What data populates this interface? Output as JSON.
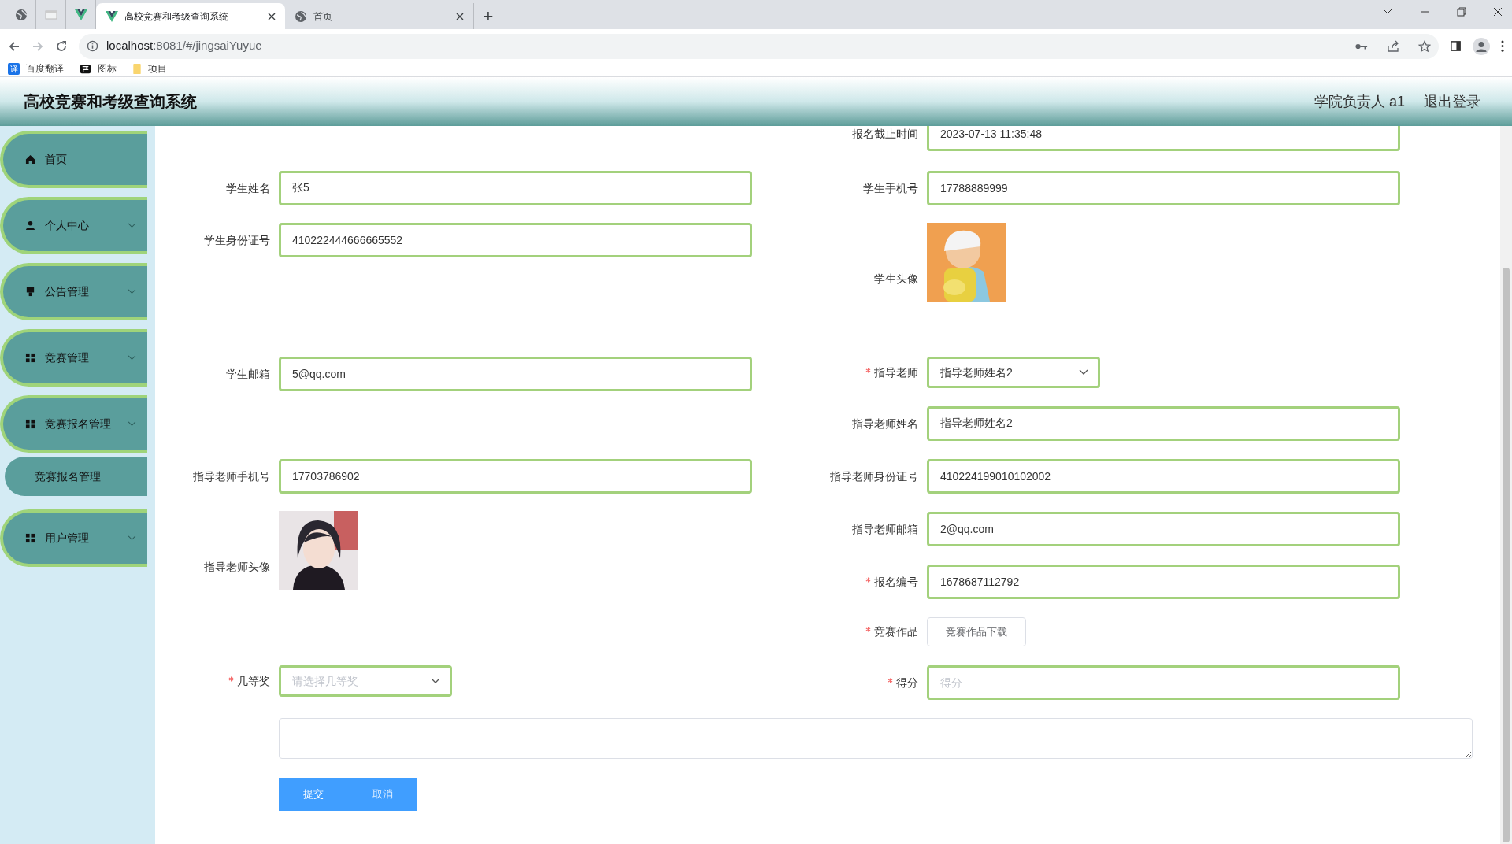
{
  "browser": {
    "tabs": [
      {
        "kind": "pinned",
        "selected": false
      },
      {
        "kind": "pinned",
        "selected": false
      },
      {
        "kind": "pinned",
        "selected": false
      },
      {
        "kind": "tab",
        "title": "高校竞赛和考级查询系统",
        "selected": true
      },
      {
        "kind": "tab",
        "title": "首页",
        "selected": false
      }
    ],
    "new_tab": "+",
    "address": {
      "host": "localhost",
      "rest": ":8081/#/jingsaiYuyue"
    },
    "bookmarks": [
      {
        "badge": "译",
        "label": "百度翻译"
      },
      {
        "label": "图标"
      },
      {
        "label": "项目"
      }
    ]
  },
  "header": {
    "title": "高校竞赛和考级查询系统",
    "user": "学院负责人 a1",
    "logout": "退出登录"
  },
  "sidebar": {
    "items": [
      {
        "label": "首页",
        "has_arrow": false
      },
      {
        "label": "个人中心",
        "has_arrow": true
      },
      {
        "label": "公告管理",
        "has_arrow": true
      },
      {
        "label": "竞赛管理",
        "has_arrow": true
      },
      {
        "label": "竞赛报名管理",
        "has_arrow": true,
        "children": [
          {
            "label": "竞赛报名管理"
          }
        ]
      },
      {
        "label": "用户管理",
        "has_arrow": true
      }
    ]
  },
  "form": {
    "left": [
      {
        "kind": "input",
        "label": "学生姓名",
        "value": "张5",
        "required": false
      },
      {
        "kind": "input",
        "label": "学生身份证号",
        "value": "410222444666665552",
        "required": false
      },
      {
        "kind": "input",
        "label": "学生邮箱",
        "value": "5@qq.com",
        "required": false
      },
      {
        "kind": "input",
        "label": "指导老师手机号",
        "value": "17703786902",
        "required": false
      },
      {
        "label": "指导老师头像",
        "required": false
      },
      {
        "kind": "select",
        "label": "几等奖",
        "placeholder": "请选择几等奖",
        "required": true
      }
    ],
    "right": [
      {
        "kind": "input",
        "label": "报名截止时间",
        "value": "2023-07-13 11:35:48",
        "required": false
      },
      {
        "kind": "input",
        "label": "学生手机号",
        "value": "17788889999",
        "required": false
      },
      {
        "label": "学生头像",
        "required": false
      },
      {
        "kind": "select",
        "label": "指导老师",
        "value": "指导老师姓名2",
        "required": true
      },
      {
        "kind": "input",
        "label": "指导老师姓名",
        "value": "指导老师姓名2",
        "required": false
      },
      {
        "kind": "input",
        "label": "指导老师身份证号",
        "value": "410224199010102002",
        "required": false
      },
      {
        "kind": "input",
        "label": "指导老师邮箱",
        "value": "2@qq.com",
        "required": false
      },
      {
        "kind": "input",
        "label": "报名编号",
        "value": "1678687112792",
        "required": true
      },
      {
        "kind": "button",
        "label": "竞赛作品",
        "button": "竞赛作品下载",
        "required": true
      },
      {
        "kind": "input",
        "label": "得分",
        "placeholder": "得分",
        "required": true
      }
    ],
    "buttons": [
      {
        "label": "提交",
        "faded": false
      },
      {
        "label": "取消",
        "faded": true
      }
    ]
  }
}
